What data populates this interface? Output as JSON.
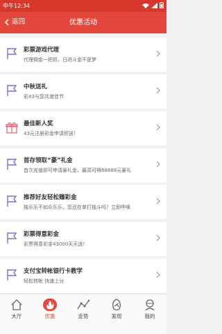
{
  "status": {
    "time": "中午12:34"
  },
  "nav": {
    "back_label": "返回",
    "title": "优惠活动"
  },
  "promos": [
    {
      "title": "彩票游戏代理",
      "subtitle": "代理佣金一把抓，日进斗金不是梦",
      "icon": "flag-icon"
    },
    {
      "title": "中秋送礼",
      "subtitle": "彩43与您共渡佳节",
      "icon": "flag-icon"
    },
    {
      "title": "最佳新人奖",
      "subtitle": "43元注册彩金申请即送！",
      "icon": "gift-icon"
    },
    {
      "title": "首存领取“豪”礼金",
      "subtitle": "首次充值即可申请豪礼金，最高可得68888元豪礼",
      "icon": "flag-icon"
    },
    {
      "title": "推荐好友轻松赚彩金",
      "subtitle": "独乐乐不如众乐乐，您还在单打独斗吗？立即呼唤",
      "icon": "flag-icon"
    },
    {
      "title": "彩票得意彩金",
      "subtitle": "彩票得意彩金43000天天送！",
      "icon": "flag-icon"
    },
    {
      "title": "支付宝转帐银行卡教学",
      "subtitle": "轻松转帐 快速上分",
      "icon": "flag-icon"
    }
  ],
  "tabs": [
    {
      "label": "大厅",
      "icon": "home-icon"
    },
    {
      "label": "优惠",
      "icon": "hot-icon"
    },
    {
      "label": "走势",
      "icon": "trend-icon"
    },
    {
      "label": "发现",
      "icon": "discover-icon"
    },
    {
      "label": "我的",
      "icon": "profile-icon"
    }
  ],
  "colors": {
    "accent": "#e2493c",
    "flag": "#7b6fd2",
    "gift": "#e26b86"
  }
}
